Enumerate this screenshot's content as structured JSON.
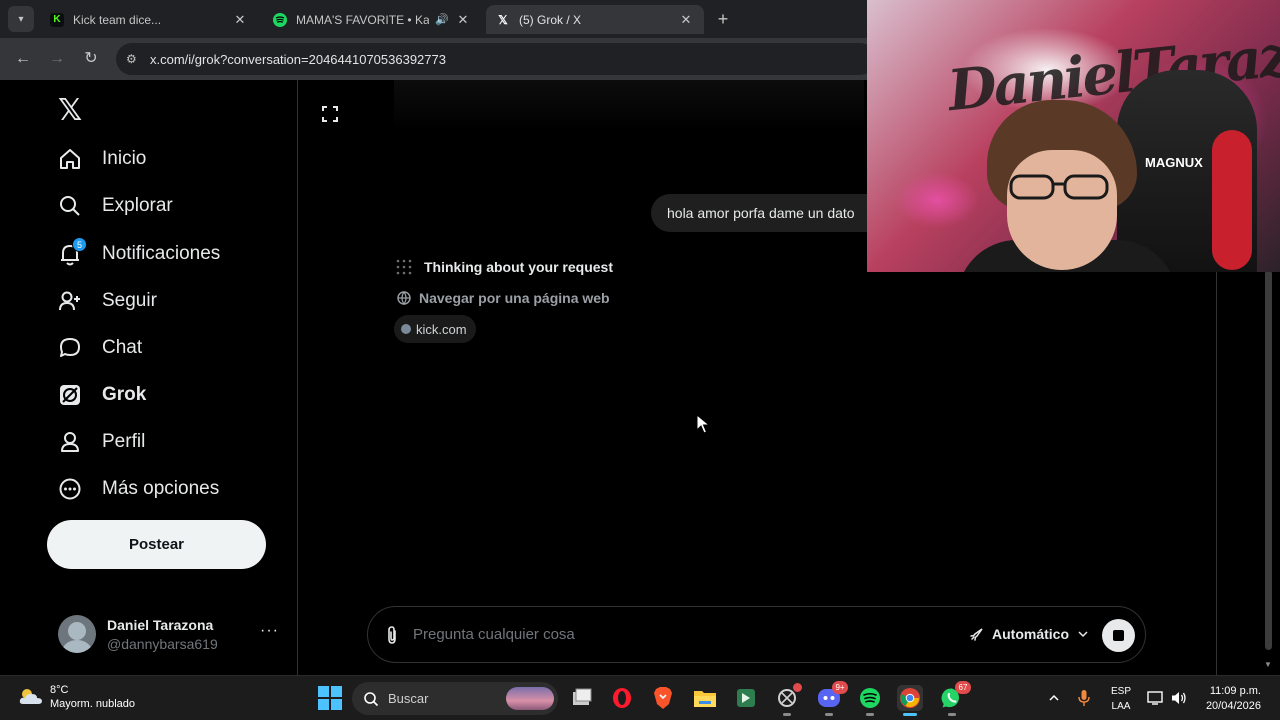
{
  "browser": {
    "tabs": [
      {
        "title": "Kick team dice...",
        "favicon": "kick-icon",
        "color": "#53fc18"
      },
      {
        "title": "MAMA'S FAVORITE • Kanye",
        "favicon": "spotify-icon",
        "color": "#1ed760"
      },
      {
        "title": "(5) Grok / X",
        "favicon": "x-icon",
        "color": "#ffffff"
      }
    ],
    "url": "x.com/i/grok?conversation=2046441070536392773"
  },
  "sidebar": {
    "logo": "𝕏",
    "items": [
      {
        "label": "Inicio",
        "icon": "home-icon"
      },
      {
        "label": "Explorar",
        "icon": "search-icon"
      },
      {
        "label": "Notificaciones",
        "icon": "bell-icon",
        "badge": "5"
      },
      {
        "label": "Seguir",
        "icon": "follow-icon"
      },
      {
        "label": "Chat",
        "icon": "chat-icon"
      },
      {
        "label": "Grok",
        "icon": "grok-icon"
      },
      {
        "label": "Perfil",
        "icon": "profile-icon"
      },
      {
        "label": "Más opciones",
        "icon": "more-icon"
      }
    ],
    "post_label": "Postear",
    "account": {
      "name": "Daniel Tarazona",
      "handle": "@dannybarsa619",
      "more": "···"
    }
  },
  "chat": {
    "user_message": "hola amor porfa dame un dato",
    "status": "Thinking about your request",
    "step": "Navegar por una página web",
    "source_chip": "kick.com",
    "composer": {
      "placeholder": "Pregunta cualquier cosa",
      "mode": "Automático"
    }
  },
  "webcam": {
    "wall_text": "Daniel Tarazona",
    "chair_brand": "MAGNUX"
  },
  "taskbar": {
    "weather": {
      "temp": "8°C",
      "desc": "Mayorm. nublado"
    },
    "search_placeholder": "Buscar",
    "discord_badge": "9+",
    "whatsapp_badge": "67",
    "lang_top": "ESP",
    "lang_bottom": "LAA",
    "time": "11:09 p.m.",
    "date": "20/04/2026"
  },
  "colors": {
    "accent": "#1d9bf0",
    "background": "#000000",
    "border": "#2f3336"
  }
}
